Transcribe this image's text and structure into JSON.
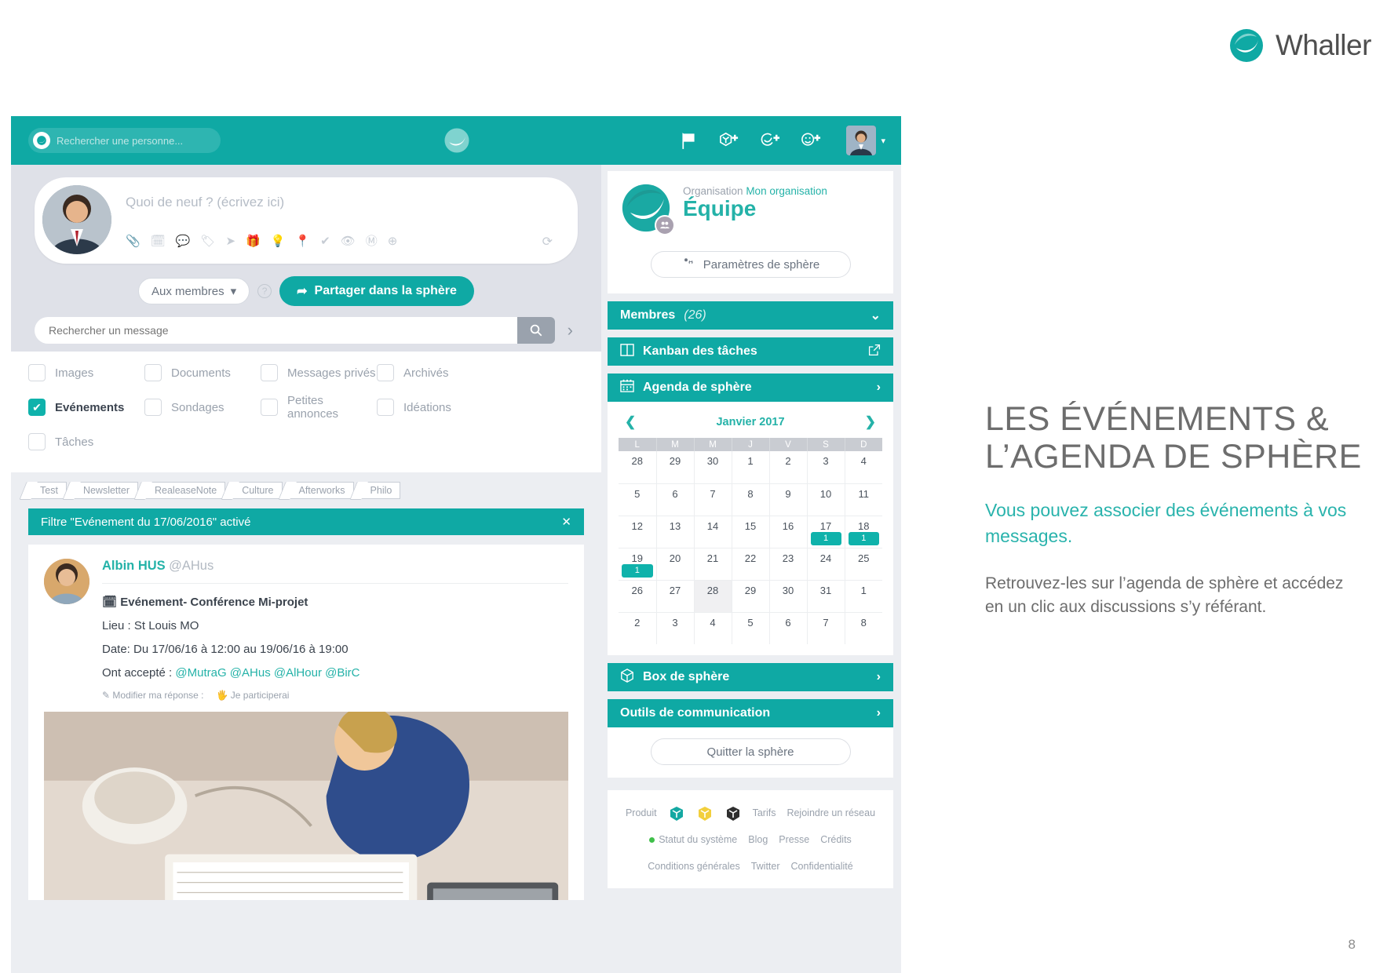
{
  "brand": {
    "name": "Whaller"
  },
  "page_number": "8",
  "appbar": {
    "search_placeholder": "Rechercher une personne...",
    "search_icon": "whaller-search-icon",
    "icons": [
      "flag-icon",
      "create-sphere-icon",
      "create-circle-icon",
      "invite-person-icon"
    ],
    "avatar": "user-avatar",
    "caret": "chevron-down-icon"
  },
  "composer": {
    "placeholder": "Quoi de neuf ? (écrivez ici)",
    "tool_icons": [
      "attachment-icon",
      "calendar-icon",
      "comment-icon",
      "tag-icon",
      "send-icon",
      "gift-icon",
      "bulb-icon",
      "location-icon",
      "check-icon",
      "eye-icon",
      "markdown-icon",
      "plus-circle-icon"
    ],
    "refresh_icon": "refresh-icon",
    "audience_label": "Aux membres",
    "audience_caret": "caret-down-icon",
    "help_icon": "help-icon",
    "share_label": "Partager dans la sphère",
    "share_icon": "share-arrow-icon"
  },
  "message_search": {
    "placeholder": "Rechercher un message",
    "value": "",
    "search_icon": "search-icon",
    "expand_icon": "chevron-right-icon"
  },
  "filters": {
    "items": [
      {
        "label": "Images",
        "checked": false
      },
      {
        "label": "Documents",
        "checked": false
      },
      {
        "label": "Messages privés",
        "checked": false
      },
      {
        "label": "Archivés",
        "checked": false
      },
      {
        "label": "Evénements",
        "checked": true
      },
      {
        "label": "Sondages",
        "checked": false
      },
      {
        "label": "Petites annonces",
        "checked": false
      },
      {
        "label": "Idéations",
        "checked": false
      },
      {
        "label": "Tâches",
        "checked": false
      }
    ]
  },
  "tags": [
    "Test",
    "Newsletter",
    "RealeaseNote",
    "Culture",
    "Afterworks",
    "Philo"
  ],
  "filter_banner": {
    "text": "Filtre \"Evénement du 17/06/2016\" activé",
    "close_icon": "close-icon"
  },
  "post": {
    "author_name": "Albin HUS",
    "author_handle": "@AHus",
    "event_icon": "calendar-icon",
    "title": "Evénement- Conférence Mi-projet",
    "place": "Lieu : St Louis MO",
    "date": "Date: Du 17/06/16 à 12:00 au 19/06/16 à 19:00",
    "accepted_lead": "Ont accepté : ",
    "accepted": "@MutraG @AHus @AlHour @BirC",
    "modify_label": "Modifier ma réponse :",
    "modify_icon": "pencil-icon",
    "participate_label": "Je participerai",
    "participate_icon": "hand-icon"
  },
  "sphere": {
    "org_label": "Organisation",
    "org_name": "Mon organisation",
    "title": "Équipe",
    "badge_icon": "group-icon",
    "settings_label": "Paramètres de sphère",
    "settings_icon": "gears-icon",
    "nav": [
      {
        "label": "Membres",
        "count": "(26)",
        "icon": null,
        "right_icon": "chevron-down-icon"
      },
      {
        "label": "Kanban des tâches",
        "icon": "kanban-icon",
        "right_icon": "external-link-icon"
      },
      {
        "label": "Agenda de sphère",
        "icon": "calendar-icon",
        "right_icon": "chevron-right-icon"
      }
    ],
    "nav_bottom": [
      {
        "label": "Box de sphère",
        "icon": "box-icon",
        "right_icon": "chevron-right-icon"
      },
      {
        "label": "Outils de communication",
        "icon": null,
        "right_icon": "chevron-right-icon"
      }
    ],
    "quit_label": "Quitter la sphère"
  },
  "calendar": {
    "prev_icon": "chevron-left-icon",
    "next_icon": "chevron-right-icon",
    "month_label": "Janvier 2017",
    "weekdays": [
      "L",
      "M",
      "M",
      "J",
      "V",
      "S",
      "D"
    ],
    "weeks": [
      [
        {
          "d": "28",
          "muted": true
        },
        {
          "d": "29",
          "muted": true
        },
        {
          "d": "30",
          "muted": true
        },
        {
          "d": "1"
        },
        {
          "d": "2"
        },
        {
          "d": "3"
        },
        {
          "d": "4"
        }
      ],
      [
        {
          "d": "5"
        },
        {
          "d": "6"
        },
        {
          "d": "7"
        },
        {
          "d": "8"
        },
        {
          "d": "9"
        },
        {
          "d": "10"
        },
        {
          "d": "11"
        }
      ],
      [
        {
          "d": "12"
        },
        {
          "d": "13"
        },
        {
          "d": "14"
        },
        {
          "d": "15"
        },
        {
          "d": "16"
        },
        {
          "d": "17",
          "badge": "1"
        },
        {
          "d": "18",
          "badge": "1"
        }
      ],
      [
        {
          "d": "19",
          "badge": "1"
        },
        {
          "d": "20"
        },
        {
          "d": "21"
        },
        {
          "d": "22"
        },
        {
          "d": "23"
        },
        {
          "d": "24"
        },
        {
          "d": "25"
        }
      ],
      [
        {
          "d": "26"
        },
        {
          "d": "27"
        },
        {
          "d": "28",
          "today": true
        },
        {
          "d": "29"
        },
        {
          "d": "30"
        },
        {
          "d": "31"
        },
        {
          "d": "1",
          "muted": true
        }
      ],
      [
        {
          "d": "2",
          "muted": true
        },
        {
          "d": "3",
          "muted": true
        },
        {
          "d": "4",
          "muted": true
        },
        {
          "d": "5",
          "muted": true
        },
        {
          "d": "6",
          "muted": true
        },
        {
          "d": "7",
          "muted": true
        },
        {
          "d": "8",
          "muted": true
        }
      ]
    ]
  },
  "footer": {
    "links": [
      "Produit",
      "Tarifs",
      "Rejoindre un réseau",
      "Statut du système",
      "Blog",
      "Presse",
      "Crédits",
      "Conditions générales",
      "Twitter",
      "Confidentialité"
    ],
    "cubes": [
      "teal-cube-icon",
      "yellow-cube-icon",
      "black-cube-icon"
    ],
    "status_label": "Statut du système"
  },
  "copy": {
    "heading": "LES ÉVÉNEMENTS & L’AGENDA DE SPHÈRE",
    "lead": "Vous pouvez associer des événements à vos messages.",
    "para": "Retrouvez-les sur l’agenda de sphère et accédez en un clic aux discussions s’y référant."
  },
  "colors": {
    "brand": "#0fa9a4",
    "accent": "#24b2a8",
    "text": "#6d6d6d"
  }
}
